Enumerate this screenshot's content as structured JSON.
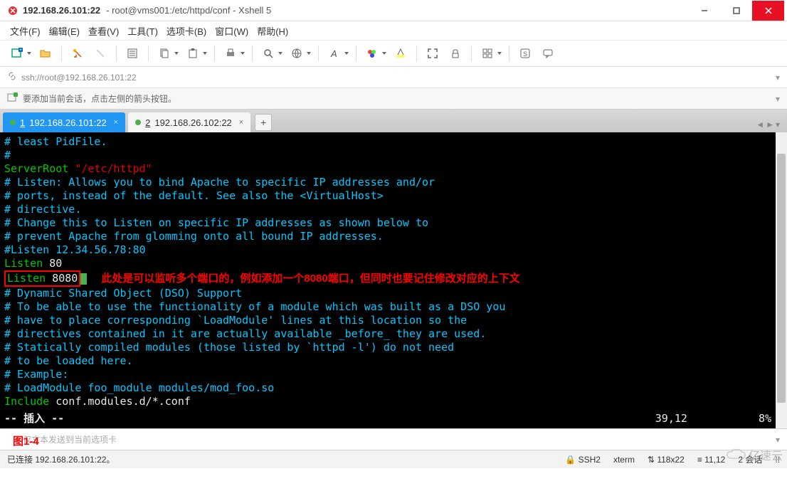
{
  "window": {
    "title": "192.168.26.101:22",
    "subtitle": " - root@vms001:/etc/httpd/conf - Xshell 5"
  },
  "menu": {
    "file": "文件(F)",
    "edit": "编辑(E)",
    "view": "查看(V)",
    "tools": "工具(T)",
    "tabs": "选项卡(B)",
    "window": "窗口(W)",
    "help": "帮助(H)"
  },
  "address": {
    "url": "ssh://root@192.168.26.101:22"
  },
  "session_hint": "要添加当前会话，点击左侧的箭头按钮。",
  "tabs": {
    "items": [
      {
        "num": "1",
        "label": "192.168.26.101:22",
        "active": true
      },
      {
        "num": "2",
        "label": "192.168.26.102:22",
        "active": false
      }
    ]
  },
  "terminal": {
    "l1": "# least PidFile.",
    "l2": "#",
    "l3a": "ServerRoot",
    "l3b": " \"/etc/httpd\"",
    "l4": "# Listen: Allows you to bind Apache to specific IP addresses and/or",
    "l5": "# ports, instead of the default. See also the <VirtualHost>",
    "l6": "# directive.",
    "l7": "# Change this to Listen on specific IP addresses as shown below to",
    "l8": "# prevent Apache from glomming onto all bound IP addresses.",
    "l9": "#Listen 12.34.56.78:80",
    "l10a": "Listen",
    "l10b": " 80",
    "l11a": "Listen",
    "l11b": " 8080",
    "annotation": "此处是可以监听多个端口的，例如添加一个8080端口，但同时也要记住修改对应的上下文",
    "l12": "# Dynamic Shared Object (DSO) Support",
    "l13": "# To be able to use the functionality of a module which was built as a DSO you",
    "l14": "# have to place corresponding `LoadModule' lines at this location so the",
    "l15": "# directives contained in it are actually available _before_ they are used.",
    "l16": "# Statically compiled modules (those listed by `httpd -l') do not need",
    "l17": "# to be loaded here.",
    "l18": "# Example:",
    "l19": "# LoadModule foo_module modules/mod_foo.so",
    "l20a": "Include",
    "l20b": " conf.modules.d/*.conf",
    "mode": "-- 插入 --",
    "pos": "39,12",
    "pct": "8%"
  },
  "input_placeholder": "仅文本发送到当前选项卡",
  "figure_label": "图1-4",
  "status": {
    "connected": "已连接 192.168.26.101:22。",
    "protocol": "SSH2",
    "term": "xterm",
    "size": "118x22",
    "cursor": "11,12",
    "sessions": "2 会话"
  },
  "watermark": "亿速云"
}
